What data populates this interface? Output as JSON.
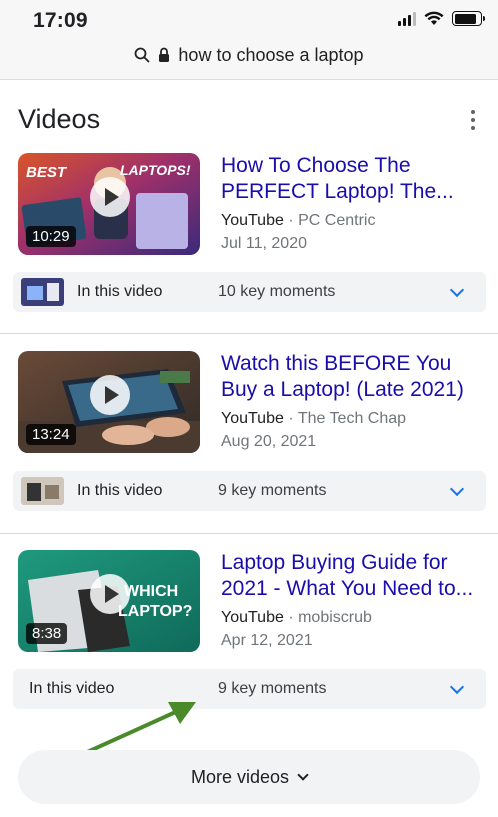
{
  "status_bar": {
    "time": "17:09",
    "icons": [
      "signal-icon",
      "wifi-icon",
      "battery-icon"
    ]
  },
  "url_bar": {
    "query": "how to choose a laptop",
    "icons": [
      "search-icon",
      "lock-icon"
    ]
  },
  "section": {
    "title": "Videos"
  },
  "videos": [
    {
      "title_line1": "How To Choose The",
      "title_line2": "PERFECT Laptop! The...",
      "duration": "10:29",
      "source": "YouTube",
      "channel": "PC Centric",
      "separator": " · ",
      "date": "Jul 11, 2020",
      "key_label": "In this video",
      "key_moments": "10 key moments",
      "thumb_text": "BEST LAPTOPS!"
    },
    {
      "title_line1": "Watch this BEFORE You",
      "title_line2": "Buy a Laptop! (Late 2021)",
      "duration": "13:24",
      "source": "YouTube",
      "channel": "The Tech Chap",
      "separator": " · ",
      "date": "Aug 20, 2021",
      "key_label": "In this video",
      "key_moments": "9 key moments"
    },
    {
      "title_line1": "Laptop Buying Guide for",
      "title_line2": "2021 - What You Need to...",
      "duration": "8:38",
      "source": "YouTube",
      "channel": "mobiscrub",
      "separator": " · ",
      "date": "Apr 12, 2021",
      "key_label": "In this video",
      "key_moments": "9 key moments",
      "thumb_text": "WHICH LAPTOP?"
    }
  ],
  "more_videos": {
    "label": "More videos"
  },
  "colors": {
    "link": "#1a0dab",
    "accent": "#1a73e8",
    "annotation_arrow": "#4a8a2a"
  }
}
